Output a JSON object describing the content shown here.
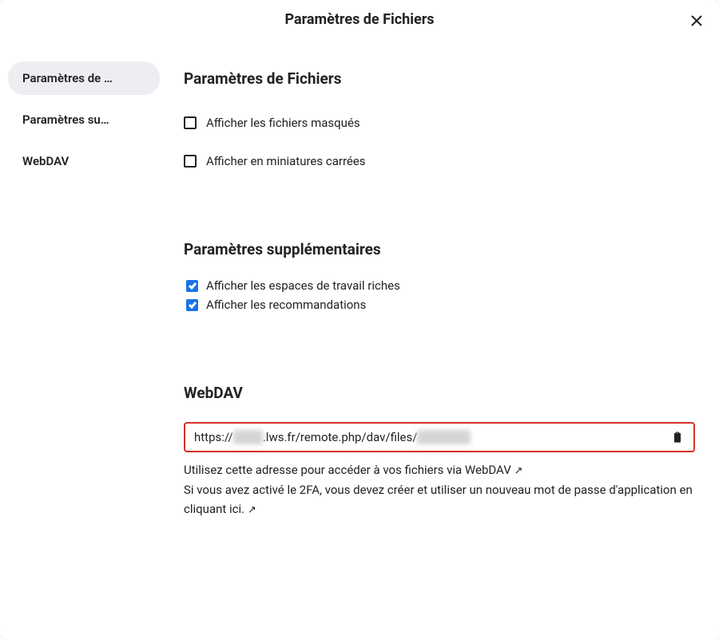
{
  "header": {
    "title": "Paramètres de Fichiers"
  },
  "sidebar": {
    "items": [
      {
        "label": "Paramètres de …",
        "active": true
      },
      {
        "label": "Paramètres su…",
        "active": false
      },
      {
        "label": "WebDAV",
        "active": false
      }
    ]
  },
  "sections": {
    "files": {
      "title": "Paramètres de Fichiers",
      "checkbox_hidden": {
        "label": "Afficher les fichiers masqués",
        "checked": false
      },
      "checkbox_square": {
        "label": "Afficher en miniatures carrées",
        "checked": false
      }
    },
    "additional": {
      "title": "Paramètres supplémentaires",
      "checkbox_workspaces": {
        "label": "Afficher les espaces de travail riches",
        "checked": true
      },
      "checkbox_recommendations": {
        "label": "Afficher les recommandations",
        "checked": true
      }
    },
    "webdav": {
      "title": "WebDAV",
      "url_prefix": "https://",
      "url_host_masked": "xxxxx",
      "url_mid": ".lws.fr/remote.php/dav/files/",
      "url_user_masked": "xxxxxxxxx",
      "help1": "Utilisez cette adresse pour accéder à vos fichiers via WebDAV",
      "help2a": "Si vous avez activé le 2FA, vous devez créer et utiliser un nouveau mot de passe d'application",
      "help2b": "en cliquant ici.",
      "arrow": "↗"
    }
  }
}
